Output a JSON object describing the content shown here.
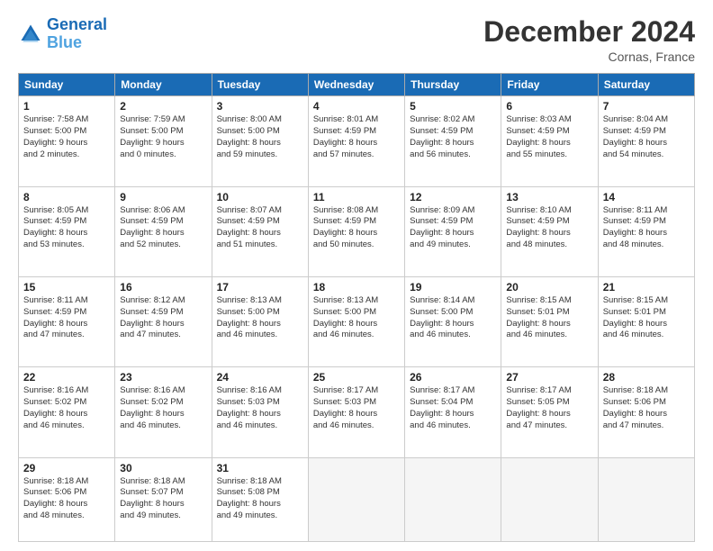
{
  "logo": {
    "line1": "General",
    "line2": "Blue"
  },
  "title": "December 2024",
  "location": "Cornas, France",
  "days_header": [
    "Sunday",
    "Monday",
    "Tuesday",
    "Wednesday",
    "Thursday",
    "Friday",
    "Saturday"
  ],
  "weeks": [
    [
      {
        "day": "1",
        "info": "Sunrise: 7:58 AM\nSunset: 5:00 PM\nDaylight: 9 hours\nand 2 minutes."
      },
      {
        "day": "2",
        "info": "Sunrise: 7:59 AM\nSunset: 5:00 PM\nDaylight: 9 hours\nand 0 minutes."
      },
      {
        "day": "3",
        "info": "Sunrise: 8:00 AM\nSunset: 5:00 PM\nDaylight: 8 hours\nand 59 minutes."
      },
      {
        "day": "4",
        "info": "Sunrise: 8:01 AM\nSunset: 4:59 PM\nDaylight: 8 hours\nand 57 minutes."
      },
      {
        "day": "5",
        "info": "Sunrise: 8:02 AM\nSunset: 4:59 PM\nDaylight: 8 hours\nand 56 minutes."
      },
      {
        "day": "6",
        "info": "Sunrise: 8:03 AM\nSunset: 4:59 PM\nDaylight: 8 hours\nand 55 minutes."
      },
      {
        "day": "7",
        "info": "Sunrise: 8:04 AM\nSunset: 4:59 PM\nDaylight: 8 hours\nand 54 minutes."
      }
    ],
    [
      {
        "day": "8",
        "info": "Sunrise: 8:05 AM\nSunset: 4:59 PM\nDaylight: 8 hours\nand 53 minutes."
      },
      {
        "day": "9",
        "info": "Sunrise: 8:06 AM\nSunset: 4:59 PM\nDaylight: 8 hours\nand 52 minutes."
      },
      {
        "day": "10",
        "info": "Sunrise: 8:07 AM\nSunset: 4:59 PM\nDaylight: 8 hours\nand 51 minutes."
      },
      {
        "day": "11",
        "info": "Sunrise: 8:08 AM\nSunset: 4:59 PM\nDaylight: 8 hours\nand 50 minutes."
      },
      {
        "day": "12",
        "info": "Sunrise: 8:09 AM\nSunset: 4:59 PM\nDaylight: 8 hours\nand 49 minutes."
      },
      {
        "day": "13",
        "info": "Sunrise: 8:10 AM\nSunset: 4:59 PM\nDaylight: 8 hours\nand 48 minutes."
      },
      {
        "day": "14",
        "info": "Sunrise: 8:11 AM\nSunset: 4:59 PM\nDaylight: 8 hours\nand 48 minutes."
      }
    ],
    [
      {
        "day": "15",
        "info": "Sunrise: 8:11 AM\nSunset: 4:59 PM\nDaylight: 8 hours\nand 47 minutes."
      },
      {
        "day": "16",
        "info": "Sunrise: 8:12 AM\nSunset: 4:59 PM\nDaylight: 8 hours\nand 47 minutes."
      },
      {
        "day": "17",
        "info": "Sunrise: 8:13 AM\nSunset: 5:00 PM\nDaylight: 8 hours\nand 46 minutes."
      },
      {
        "day": "18",
        "info": "Sunrise: 8:13 AM\nSunset: 5:00 PM\nDaylight: 8 hours\nand 46 minutes."
      },
      {
        "day": "19",
        "info": "Sunrise: 8:14 AM\nSunset: 5:00 PM\nDaylight: 8 hours\nand 46 minutes."
      },
      {
        "day": "20",
        "info": "Sunrise: 8:15 AM\nSunset: 5:01 PM\nDaylight: 8 hours\nand 46 minutes."
      },
      {
        "day": "21",
        "info": "Sunrise: 8:15 AM\nSunset: 5:01 PM\nDaylight: 8 hours\nand 46 minutes."
      }
    ],
    [
      {
        "day": "22",
        "info": "Sunrise: 8:16 AM\nSunset: 5:02 PM\nDaylight: 8 hours\nand 46 minutes."
      },
      {
        "day": "23",
        "info": "Sunrise: 8:16 AM\nSunset: 5:02 PM\nDaylight: 8 hours\nand 46 minutes."
      },
      {
        "day": "24",
        "info": "Sunrise: 8:16 AM\nSunset: 5:03 PM\nDaylight: 8 hours\nand 46 minutes."
      },
      {
        "day": "25",
        "info": "Sunrise: 8:17 AM\nSunset: 5:03 PM\nDaylight: 8 hours\nand 46 minutes."
      },
      {
        "day": "26",
        "info": "Sunrise: 8:17 AM\nSunset: 5:04 PM\nDaylight: 8 hours\nand 46 minutes."
      },
      {
        "day": "27",
        "info": "Sunrise: 8:17 AM\nSunset: 5:05 PM\nDaylight: 8 hours\nand 47 minutes."
      },
      {
        "day": "28",
        "info": "Sunrise: 8:18 AM\nSunset: 5:06 PM\nDaylight: 8 hours\nand 47 minutes."
      }
    ],
    [
      {
        "day": "29",
        "info": "Sunrise: 8:18 AM\nSunset: 5:06 PM\nDaylight: 8 hours\nand 48 minutes."
      },
      {
        "day": "30",
        "info": "Sunrise: 8:18 AM\nSunset: 5:07 PM\nDaylight: 8 hours\nand 49 minutes."
      },
      {
        "day": "31",
        "info": "Sunrise: 8:18 AM\nSunset: 5:08 PM\nDaylight: 8 hours\nand 49 minutes."
      },
      null,
      null,
      null,
      null
    ]
  ]
}
